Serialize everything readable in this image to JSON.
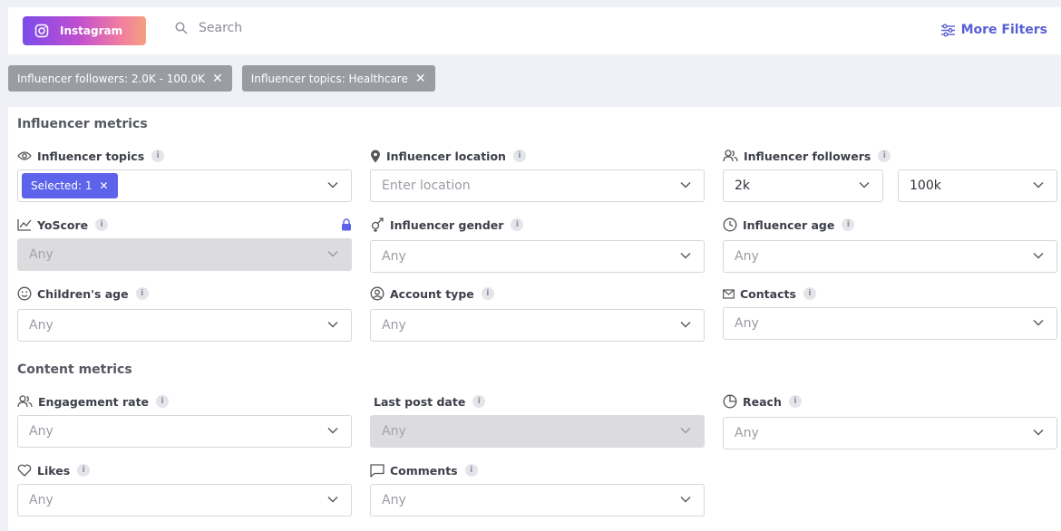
{
  "topbar": {
    "platform_label": "Instagram",
    "search_placeholder": "Search",
    "more_filters_label": "More Filters"
  },
  "active_filters": [
    {
      "label": "Influencer followers: 2.0K - 100.0K"
    },
    {
      "label": "Influencer topics: Healthcare"
    }
  ],
  "influencer_metrics": {
    "title": "Influencer metrics",
    "topics": {
      "label": "Influencer topics",
      "selected_badge": "Selected: 1"
    },
    "location": {
      "label": "Influencer location",
      "placeholder": "Enter location"
    },
    "followers": {
      "label": "Influencer followers",
      "min": "2k",
      "max": "100k"
    },
    "yoscore": {
      "label": "YoScore",
      "value": "Any"
    },
    "gender": {
      "label": "Influencer gender",
      "value": "Any"
    },
    "age": {
      "label": "Influencer age",
      "value": "Any"
    },
    "children_age": {
      "label": "Children's age",
      "value": "Any"
    },
    "account_type": {
      "label": "Account type",
      "value": "Any"
    },
    "contacts": {
      "label": "Contacts",
      "value": "Any"
    }
  },
  "content_metrics": {
    "title": "Content metrics",
    "engagement_rate": {
      "label": "Engagement rate",
      "value": "Any"
    },
    "last_post_date": {
      "label": "Last post date",
      "value": "Any"
    },
    "reach": {
      "label": "Reach",
      "value": "Any"
    },
    "likes": {
      "label": "Likes",
      "value": "Any"
    },
    "comments": {
      "label": "Comments",
      "value": "Any"
    }
  },
  "info_glyph": "i"
}
